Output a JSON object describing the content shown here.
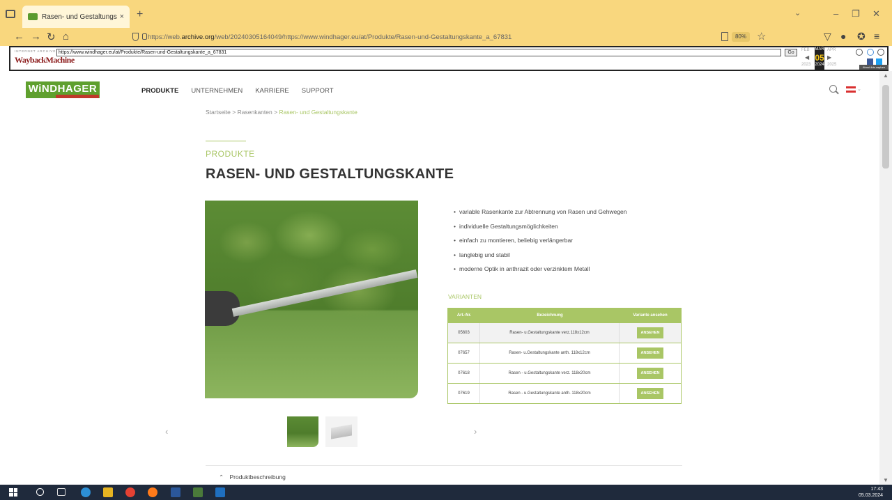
{
  "browser": {
    "tab_title": "Rasen- und Gestaltungskante |",
    "tab_close": "×",
    "new_tab": "+",
    "url_prefix": "https://web.",
    "url_domain": "archive.org",
    "url_rest": "/web/20240305164049/https://www.windhager.eu/at/Produkte/Rasen-und-Gestaltungskante_a_67831",
    "zoom": "80%"
  },
  "wayback": {
    "logo_small": "INTERNET ARCHIVE",
    "logo": "WaybackMachine",
    "url": "https://www.windhager.eu/at/Produkte/Rasen-und-Gestaltungskante_a_67831",
    "go": "Go",
    "prev_month": "FEB",
    "month": "MAR",
    "next_month": "APR",
    "day": "05",
    "prev_year": "2023",
    "year": "2024",
    "next_year": "2025",
    "about": "About this capture"
  },
  "site": {
    "logo": "WiNDHAGER",
    "nav": [
      "PRODUKTE",
      "UNTERNEHMEN",
      "KARRIERE",
      "SUPPORT"
    ],
    "breadcrumb": {
      "home": "Startseite",
      "sep": ">",
      "category": "Rasenkanten",
      "current": "Rasen- und Gestaltungskante"
    },
    "eyebrow": "PRODUKTE",
    "title": "RASEN- UND GESTALTUNGSKANTE",
    "bullets": [
      "variable Rasenkante zur Abtrennung von Rasen und Gehwegen",
      "individuelle Gestaltungsmöglichkeiten",
      "einfach zu montieren, beliebig verlängerbar",
      "langlebig und stabil",
      "moderne Optik in anthrazit oder verzinktem Metall"
    ],
    "variants_label": "VARIANTEN",
    "table": {
      "headers": [
        "Art.-Nr.",
        "Bezeichnung",
        "Variante ansehen"
      ],
      "rows": [
        {
          "art": "05603",
          "name": "Rasen- u.Gestaltungskante verz.118x12cm",
          "action": "ANSEHEN"
        },
        {
          "art": "07657",
          "name": "Rasen- u.Gestaltungskante anth. 118x12cm",
          "action": "ANSEHEN"
        },
        {
          "art": "07618",
          "name": "Rasen - u.Gestaltungskante verz. 118x20cm",
          "action": "ANSEHEN"
        },
        {
          "art": "07619",
          "name": "Rasen - u.Gestaltungskante anth. 118x20cm",
          "action": "ANSEHEN"
        }
      ]
    },
    "description_toggle": "Produktbeschreibung"
  },
  "taskbar": {
    "time": "17:43",
    "date": "05.03.2024"
  },
  "colors": {
    "accent_green": "#a9c665",
    "chrome_yellow": "#f9d77e",
    "brand_green": "#5fa02e"
  }
}
